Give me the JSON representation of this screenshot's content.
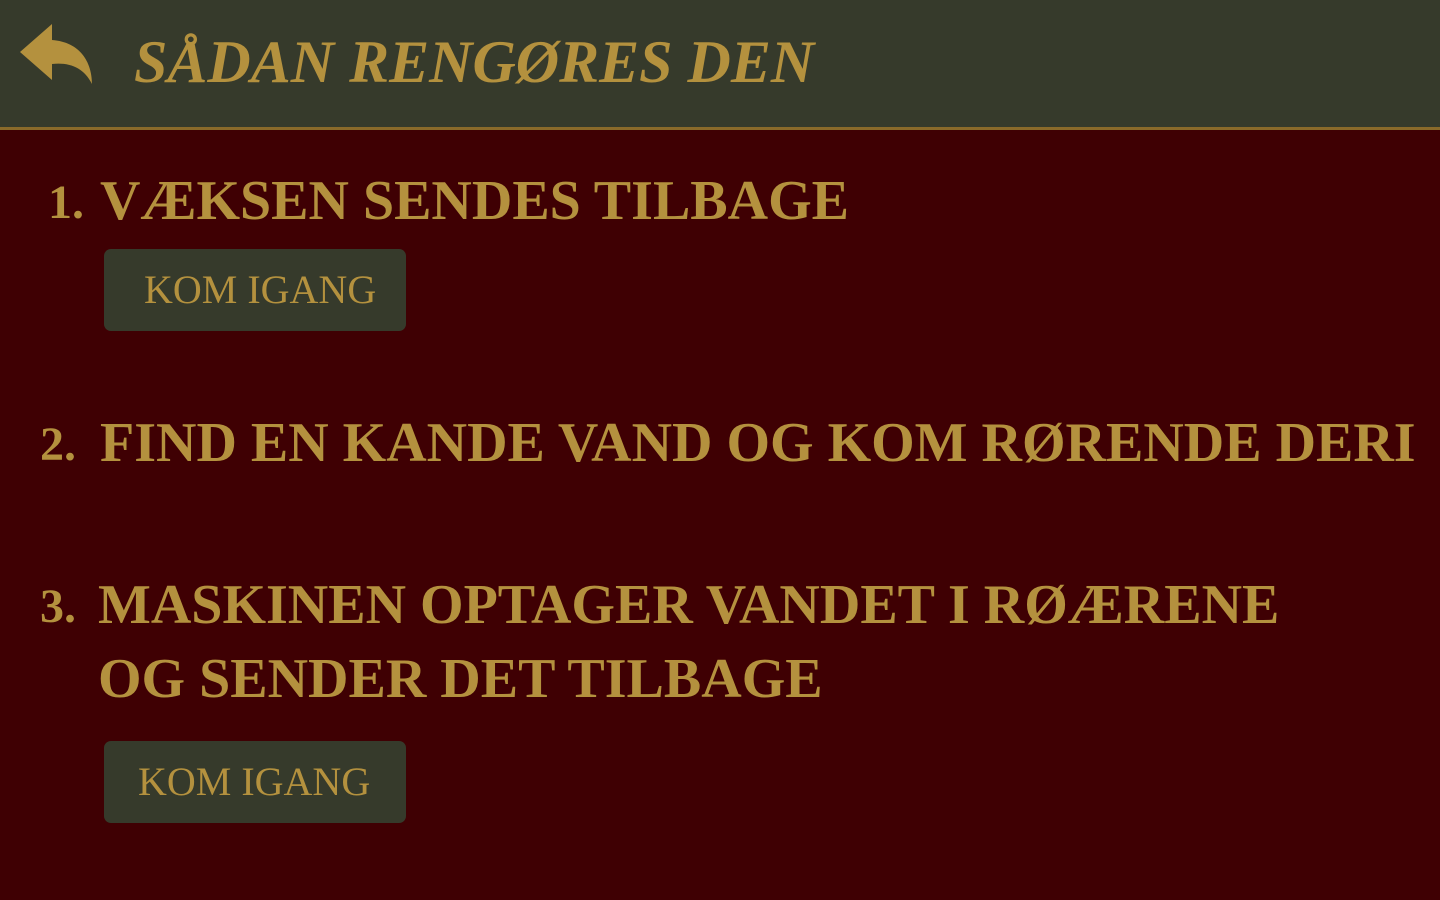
{
  "header": {
    "title": "SÅDAN RENGØRES DEN",
    "back_icon": "reply-arrow-icon"
  },
  "colors": {
    "background": "#3f0003",
    "header_bg": "#363a2b",
    "accent_gold": "#b4913e"
  },
  "steps": [
    {
      "number": "1.",
      "lines": [
        "VÆKSEN SENDES TILBAGE"
      ],
      "button_label": "KOM IGANG"
    },
    {
      "number": "2.",
      "lines": [
        "FIND EN KANDE VAND OG KOM RØRENDE DERI"
      ]
    },
    {
      "number": "3.",
      "lines": [
        "MASKINEN OPTAGER VANDET I RØÆRENE",
        "OG SENDER DET TILBAGE"
      ],
      "button_label": "KOM IGANG"
    }
  ]
}
